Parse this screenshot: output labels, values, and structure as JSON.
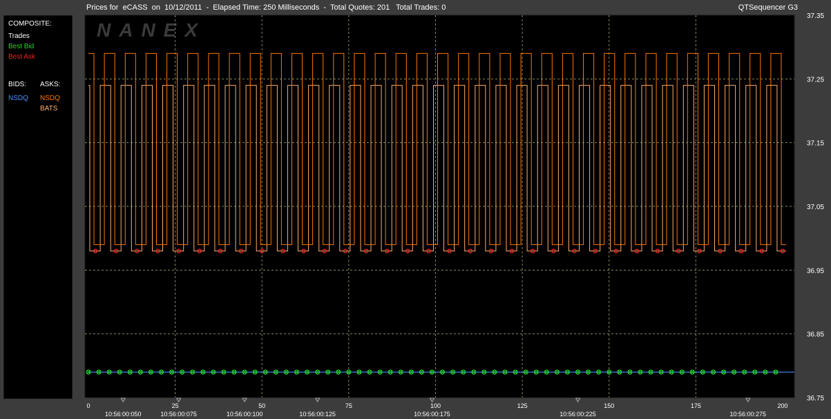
{
  "header": {
    "title": "Prices for  eCASS  on  10/12/2011  -  Elapsed Time: 250 Milliseconds  -  Total Quotes: 201   Total Trades: 0",
    "app_name": "QTSequencer G3"
  },
  "legend": {
    "composite_label": "COMPOSITE:",
    "trades": "Trades",
    "best_bid": "Best Bid",
    "best_ask": "Best Ask",
    "bids_label": "BIDS:",
    "asks_label": "ASKS:",
    "bid_exchanges": [
      "NSDQ"
    ],
    "ask_exchanges": [
      "NSDQ",
      "BATS"
    ]
  },
  "watermark": "NANEX",
  "colors": {
    "trades": "#ffffff",
    "best_bid": "#22dd22",
    "best_ask": "#ee2222",
    "nsdq_bid": "#4a90ff",
    "nsdq_ask": "#ff7700",
    "bats_ask": "#ffb070",
    "grid": "#8a8a5a"
  },
  "chart_data": {
    "type": "line",
    "title": "Prices for eCASS on 10/12/2011",
    "x_ticks": [
      0,
      25,
      50,
      75,
      100,
      125,
      150,
      175,
      200
    ],
    "x_range": [
      0,
      201
    ],
    "time_ticks": [
      {
        "label": "10:56:00:050",
        "x": 10
      },
      {
        "label": "10:56:00:075",
        "x": 26
      },
      {
        "label": "10:56:00:100",
        "x": 45
      },
      {
        "label": "10:56:00:125",
        "x": 66
      },
      {
        "label": "10:56:00:175",
        "x": 99
      },
      {
        "label": "10:56:00:225",
        "x": 141
      },
      {
        "label": "10:56:00:275",
        "x": 190
      }
    ],
    "y_ticks": [
      36.75,
      36.85,
      36.95,
      37.05,
      37.15,
      37.25,
      37.35
    ],
    "y_range": [
      36.75,
      37.35
    ],
    "series": [
      {
        "name": "NSDQ",
        "side": "ask",
        "pattern": "square-wave",
        "high": 37.29,
        "low": 36.99,
        "period": 6
      },
      {
        "name": "BATS",
        "side": "ask",
        "pattern": "square-wave",
        "high": 37.24,
        "low": 36.98,
        "period": 6
      },
      {
        "name": "Best Ask",
        "low": 36.98,
        "marker_every": 6
      },
      {
        "name": "NSDQ",
        "side": "bid",
        "value": 36.79
      },
      {
        "name": "Best Bid",
        "value": 36.79,
        "marker_every": 3
      }
    ]
  }
}
